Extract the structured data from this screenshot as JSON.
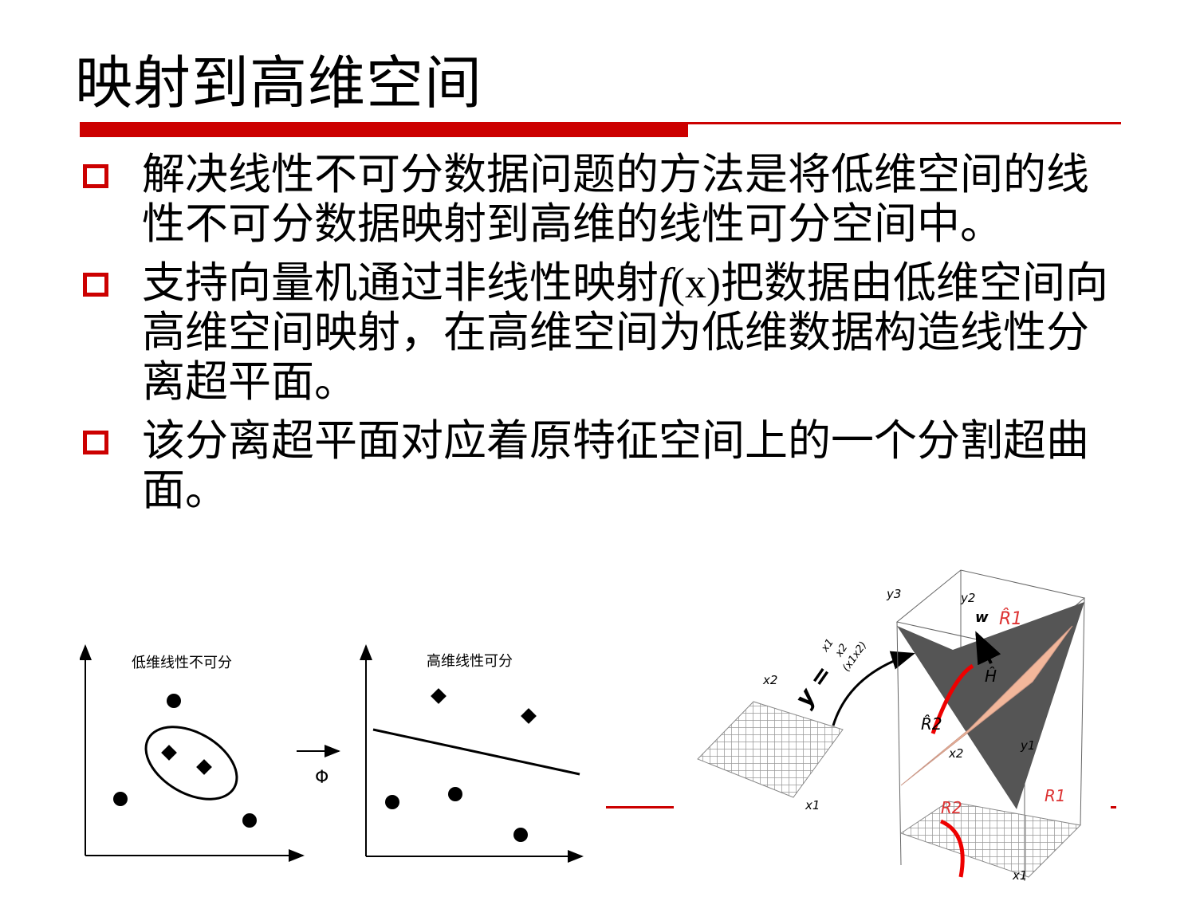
{
  "title": "映射到高维空间",
  "bullets": [
    {
      "text": "解决线性不可分数据问题的方法是将低维空间的线性不可分数据映射到高维的线性可分空间中。"
    },
    {
      "text_before": "支持向量机通过非线性映射",
      "func": "f",
      "arg": "(x)",
      "text_after": "把数据由低维空间向高维空间映射，在高维空间为低维数据构造线性分离超平面。"
    },
    {
      "text": "该分离超平面对应着原特征空间上的一个分割超曲面。"
    }
  ],
  "figure_left": {
    "label_low": "低维线性不可分",
    "label_high": "高维线性可分",
    "map_symbol": "Φ"
  },
  "figure_right": {
    "eq_lhs": "y =",
    "vector": [
      "x1",
      "x2",
      "(x1x2)"
    ],
    "labels": [
      "x2",
      "x1",
      "y3",
      "y2",
      "y1",
      "w",
      "R̂1",
      "R̂2",
      "Ĥ",
      "R1",
      "R2",
      "x2",
      "x1"
    ]
  },
  "colors": {
    "accent": "#cc0000",
    "plane": "#f2b79b",
    "surface": "#555555"
  }
}
